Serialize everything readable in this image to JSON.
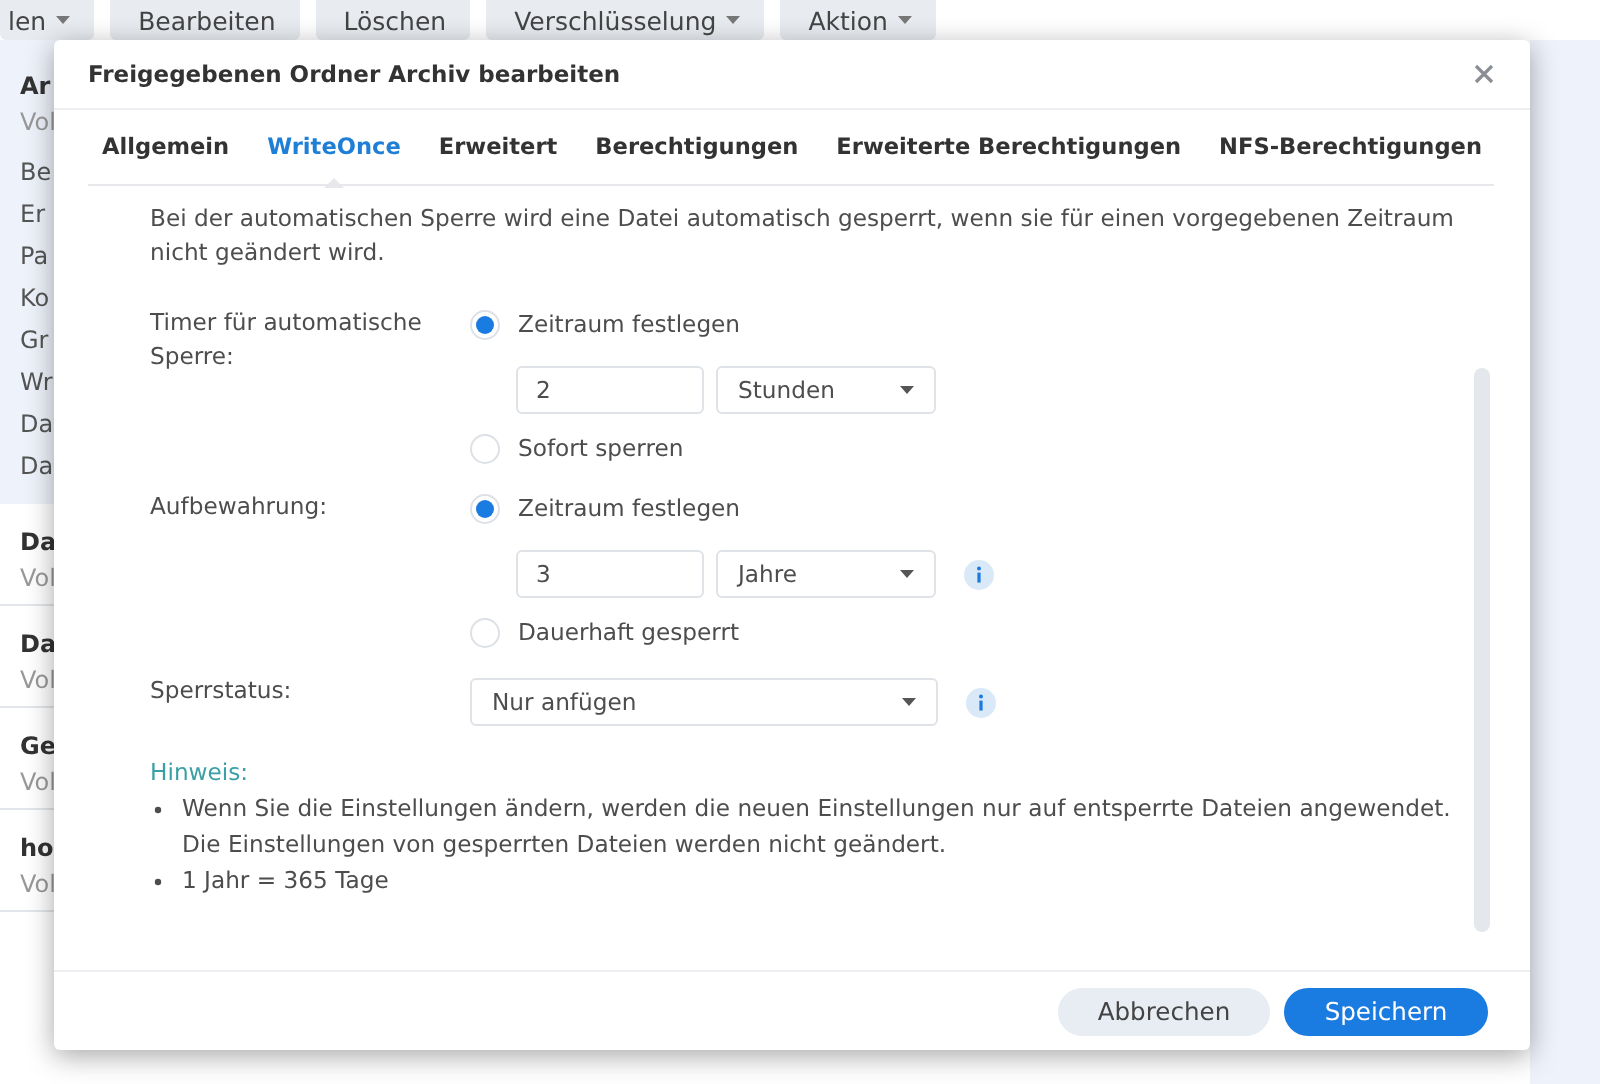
{
  "toolbar": [
    {
      "label": "len",
      "dropdown": true
    },
    {
      "label": "Bearbeiten",
      "dropdown": false
    },
    {
      "label": "Löschen",
      "dropdown": false
    },
    {
      "label": "Verschlüsselung",
      "dropdown": true
    },
    {
      "label": "Aktion",
      "dropdown": true
    }
  ],
  "background_list": {
    "selected_item": {
      "title": "Ar",
      "subtitle": "Vol",
      "details": [
        "Be",
        "Er",
        "Pa",
        "Ko",
        "Gr",
        "Wr",
        "Da",
        "Da"
      ]
    },
    "items": [
      {
        "title": "Da",
        "subtitle": "Vol"
      },
      {
        "title": "Da",
        "subtitle": "Vol"
      },
      {
        "title": "Ge",
        "subtitle": "Vol"
      },
      {
        "title": "ho",
        "subtitle": "Vol"
      }
    ]
  },
  "dialog": {
    "title": "Freigegebenen Ordner Archiv bearbeiten",
    "tabs": [
      {
        "label": "Allgemein",
        "selected": false
      },
      {
        "label": "WriteOnce",
        "selected": true
      },
      {
        "label": "Erweitert",
        "selected": false
      },
      {
        "label": "Berechtigungen",
        "selected": false
      },
      {
        "label": "Erweiterte Berechtigungen",
        "selected": false
      },
      {
        "label": "NFS-Berechtigungen",
        "selected": false
      }
    ],
    "description": "Bei der automatischen Sperre wird eine Datei automatisch gesperrt, wenn sie für einen vorgegebenen Zeitraum nicht geändert wird.",
    "sections": [
      {
        "label": "Timer für automatische Sperre:",
        "controls": [
          {
            "kind": "radio",
            "label": "Zeitraum festlegen",
            "selected": true
          },
          {
            "kind": "period",
            "value": "2",
            "unit": "Stunden",
            "info": false
          },
          {
            "kind": "radio",
            "label": "Sofort sperren",
            "selected": false
          }
        ]
      },
      {
        "label": "Aufbewahrung:",
        "controls": [
          {
            "kind": "radio",
            "label": "Zeitraum festlegen",
            "selected": true
          },
          {
            "kind": "period",
            "value": "3",
            "unit": "Jahre",
            "info": true
          },
          {
            "kind": "radio",
            "label": "Dauerhaft gesperrt",
            "selected": false
          }
        ]
      },
      {
        "label": "Sperrstatus:",
        "controls": [
          {
            "kind": "select",
            "value": "Nur anfügen",
            "info": true
          }
        ]
      }
    ],
    "hint": {
      "title": "Hinweis:",
      "bullets": [
        "Wenn Sie die Einstellungen ändern, werden die neuen Einstellungen nur auf entsperrte Dateien angewendet. Die Einstellungen von gesperrten Dateien werden nicht geändert.",
        "1 Jahr = 365 Tage"
      ]
    },
    "buttons": [
      {
        "label": "Abbrechen",
        "kind": "secondary"
      },
      {
        "label": "Speichern",
        "kind": "primary"
      }
    ]
  }
}
